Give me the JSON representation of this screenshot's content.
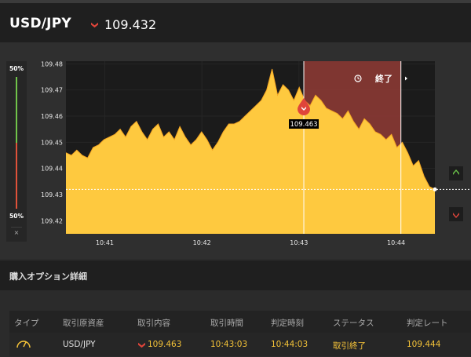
{
  "header": {
    "pair": "USD/JPY",
    "rate_direction": "down",
    "rate": "109.432"
  },
  "gauge": {
    "top_percent": "50%",
    "bottom_percent": "50%",
    "close_symbol": "×"
  },
  "chart_panel": {
    "expired_label": "終了",
    "entry_rate_label": "109.463",
    "up_button": "up",
    "down_button": "down"
  },
  "chart_data": {
    "type": "area",
    "y_ticks": [
      "109.48",
      "109.47",
      "109.46",
      "109.45",
      "109.44",
      "109.43",
      "109.42"
    ],
    "x_ticks": [
      "10:41",
      "10:42",
      "10:43",
      "10:44"
    ],
    "ylim": [
      109.415,
      109.481
    ],
    "xlim": [
      "10:40:36",
      "10:44:24"
    ],
    "series": [
      {
        "values": [
          109.446,
          109.445,
          109.447,
          109.445,
          109.444,
          109.448,
          109.449,
          109.451,
          109.452,
          109.453,
          109.455,
          109.452,
          109.456,
          109.458,
          109.454,
          109.451,
          109.455,
          109.457,
          109.452,
          109.454,
          109.451,
          109.456,
          109.452,
          109.449,
          109.451,
          109.454,
          109.451,
          109.447,
          109.45,
          109.454,
          109.457,
          109.457,
          109.458,
          109.46,
          109.462,
          109.464,
          109.466,
          109.47,
          109.478,
          109.468,
          109.472,
          109.47,
          109.466,
          109.471,
          109.466,
          109.464,
          109.468,
          109.466,
          109.463,
          109.462,
          109.461,
          109.459,
          109.462,
          109.458,
          109.455,
          109.459,
          109.457,
          109.454,
          109.453,
          109.451,
          109.453,
          109.448,
          109.45,
          109.446,
          109.441,
          109.443,
          109.437,
          109.433,
          109.432
        ]
      }
    ],
    "current_rate": 109.432,
    "entry_time": "10:43:03",
    "expiry_time": "10:44:03"
  },
  "purchase_details": {
    "title": "購入オプション詳細",
    "columns": [
      "タイプ",
      "取引原資産",
      "取引内容",
      "取引時間",
      "判定時刻",
      "ステータス",
      "判定レート"
    ],
    "row": {
      "asset": "USD/JPY",
      "direction": "down",
      "rate": "109.463",
      "trade_time": "10:43:03",
      "judge_time": "10:44:03",
      "status": "取引終了",
      "judge_rate": "109.444"
    }
  },
  "colors": {
    "area_fill": "#fec93f",
    "area_line": "#f5a623",
    "expired_zone": "#8b3a34",
    "down_red": "#e0453a",
    "up_green": "#6cc24a",
    "text_gold": "#f5c338"
  }
}
